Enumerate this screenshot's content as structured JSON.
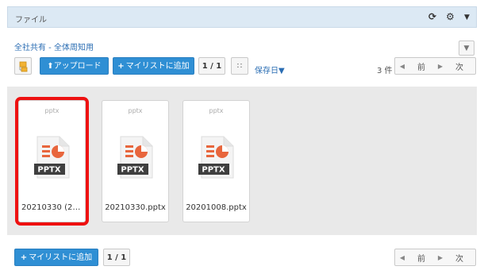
{
  "header": {
    "title": "ファイル",
    "icons": [
      "refresh-icon",
      "gear-icon",
      "caret-down-icon"
    ]
  },
  "breadcrumb": "全社共有 - 全体周知用",
  "toolbar": {
    "upload_label": "アップロード",
    "add_mylist_label": "マイリストに追加",
    "page_indicator": "1 / 1",
    "sort_label": "保存日▼",
    "count_label": "3 件",
    "prev_label": "前",
    "next_label": "次"
  },
  "files": [
    {
      "ext": "pptx",
      "name": "20210330 (2)...",
      "badge": "PPTX",
      "selected": true
    },
    {
      "ext": "pptx",
      "name": "20210330.pptx",
      "badge": "PPTX",
      "selected": false
    },
    {
      "ext": "pptx",
      "name": "20201008.pptx",
      "badge": "PPTX",
      "selected": false
    }
  ],
  "bottom": {
    "add_mylist_label": "マイリストに追加",
    "page_indicator": "1 / 1",
    "prev_label": "前",
    "next_label": "次"
  },
  "colors": {
    "accent": "#2f8fd4",
    "header_bg": "#dce9f4",
    "file_orange": "#e8663d",
    "selection": "#ee1111"
  }
}
